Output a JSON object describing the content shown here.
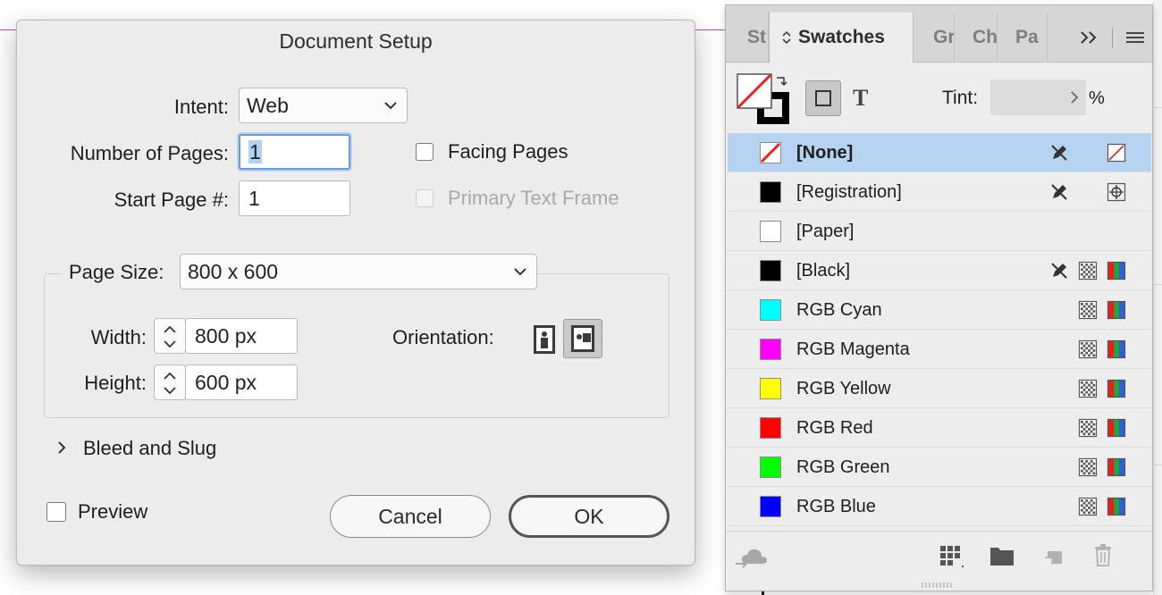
{
  "dialog": {
    "title": "Document Setup",
    "intent": {
      "label": "Intent:",
      "value": "Web"
    },
    "num_pages": {
      "label": "Number of Pages:",
      "value": "1"
    },
    "start_page": {
      "label": "Start Page #:",
      "value": "1"
    },
    "facing_pages": {
      "label": "Facing Pages",
      "checked": false
    },
    "primary_text_frame": {
      "label": "Primary Text Frame",
      "checked": false,
      "enabled": false
    },
    "page_size": {
      "label": "Page Size:",
      "value": "800 x 600"
    },
    "width": {
      "label": "Width:",
      "value": "800 px"
    },
    "height": {
      "label": "Height:",
      "value": "600 px"
    },
    "orientation": {
      "label": "Orientation:",
      "selected": "landscape"
    },
    "bleed_slug": {
      "label": "Bleed and Slug"
    },
    "preview": {
      "label": "Preview",
      "checked": false
    },
    "cancel_label": "Cancel",
    "ok_label": "OK"
  },
  "panel": {
    "tabs": [
      "St",
      "Swatches",
      "Gr",
      "Ch",
      "Pa"
    ],
    "active_tab": "Swatches",
    "tint_label": "Tint:",
    "tint_value": "",
    "tint_unit": "%",
    "swatches": [
      {
        "name": "[None]",
        "color": "none",
        "selected": true,
        "bold": true
      },
      {
        "name": "[Registration]",
        "color": "#000000"
      },
      {
        "name": "[Paper]",
        "color": "#ffffff"
      },
      {
        "name": "[Black]",
        "color": "#000000"
      },
      {
        "name": "RGB Cyan",
        "color": "#00ffff"
      },
      {
        "name": "RGB Magenta",
        "color": "#ff00ff"
      },
      {
        "name": "RGB Yellow",
        "color": "#ffff00"
      },
      {
        "name": "RGB Red",
        "color": "#ff0000"
      },
      {
        "name": "RGB Green",
        "color": "#00ff00"
      },
      {
        "name": "RGB Blue",
        "color": "#0000ff"
      }
    ]
  },
  "colors": {
    "focus": "#6a9bd8",
    "selection": "#b7d3f2",
    "guide": "#d04ad0"
  }
}
